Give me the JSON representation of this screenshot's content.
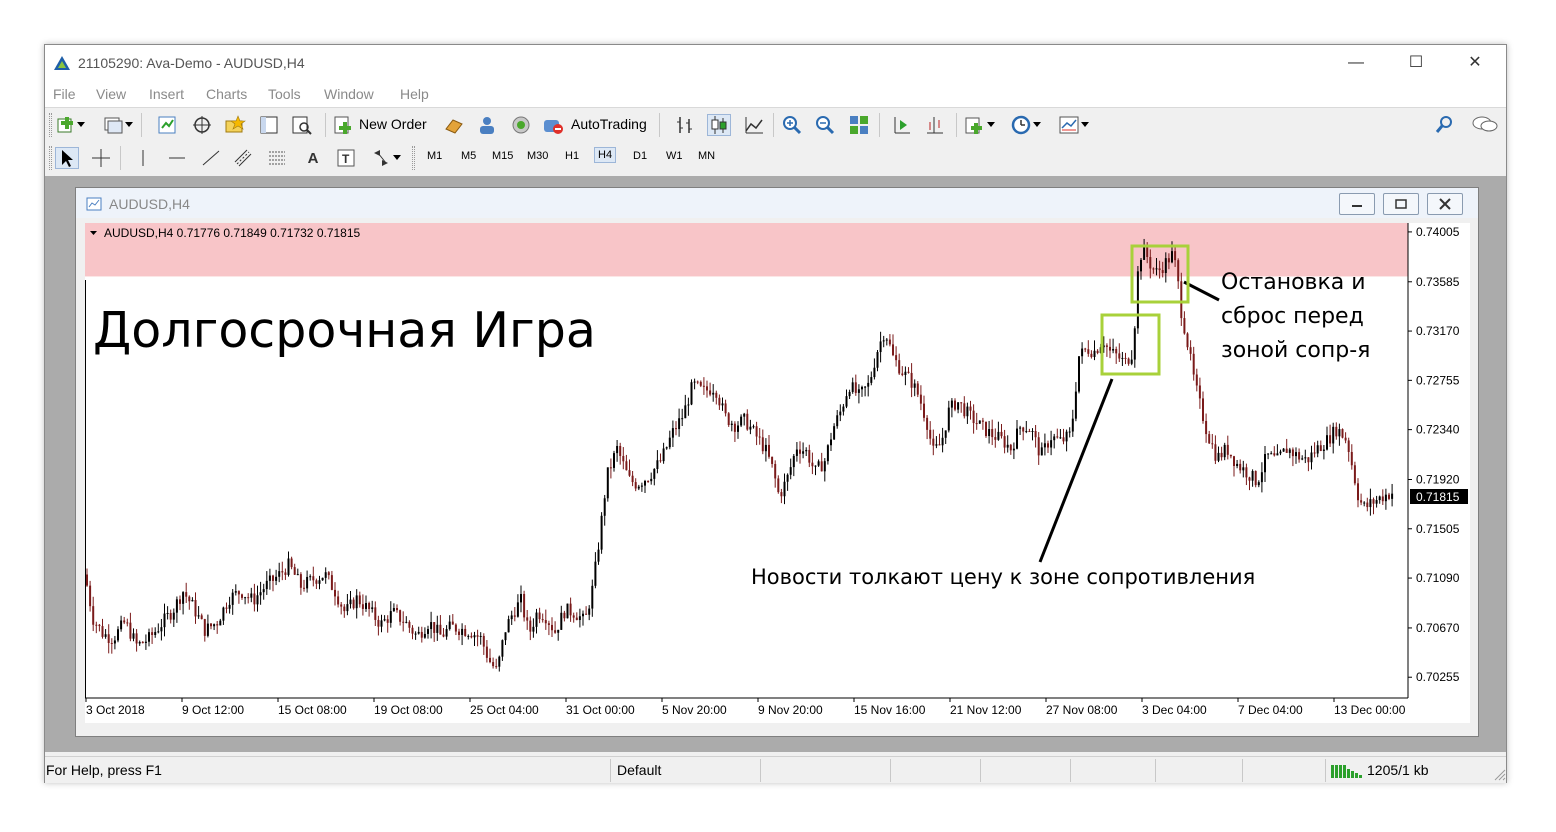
{
  "window": {
    "title": "21105290: Ava-Demo - AUDUSD,H4",
    "minimize": "—",
    "maximize": "☐",
    "close": "✕"
  },
  "menu": [
    "File",
    "View",
    "Insert",
    "Charts",
    "Tools",
    "Window",
    "Help"
  ],
  "toolbar": {
    "new_order": "New Order",
    "autotrading": "AutoTrading",
    "timeframes": [
      "M1",
      "M5",
      "M15",
      "M30",
      "H1",
      "H4",
      "D1",
      "W1",
      "MN"
    ],
    "selected_timeframe": "H4",
    "text_tool": "A"
  },
  "chart_window": {
    "title": "AUDUSD,H4",
    "info": "AUDUSD,H4  0.71776 0.71849 0.71732 0.71815",
    "current_price": "0.71815"
  },
  "annotations": {
    "heading": "Долгосрочная Игра",
    "stop_note": [
      "Остановка и",
      "сброс перед",
      "зоной сопр-я"
    ],
    "news_note": "Новости толкают цену к зоне сопротивления"
  },
  "statusbar": {
    "help": "For Help, press F1",
    "profile": "Default",
    "traffic": "1205/1 kb"
  },
  "colors": {
    "resistance_zone": "#f8c5c8",
    "candle_up": "#000000",
    "candle_down": "#7a1a1a",
    "box_highlight": "#a8d13a",
    "price_label_bg": "#000000"
  },
  "chart_data": {
    "type": "candlestick",
    "symbol": "AUDUSD",
    "timeframe": "H4",
    "y_ticks": [
      "0.74005",
      "0.73585",
      "0.73170",
      "0.72755",
      "0.72340",
      "0.71920",
      "0.71505",
      "0.71090",
      "0.70670",
      "0.70255"
    ],
    "x_ticks": [
      "3 Oct 2018",
      "9 Oct 12:00",
      "15 Oct 08:00",
      "19 Oct 08:00",
      "25 Oct 04:00",
      "31 Oct 00:00",
      "5 Nov 20:00",
      "9 Nov 20:00",
      "15 Nov 16:00",
      "21 Nov 12:00",
      "27 Nov 08:00",
      "3 Dec 04:00",
      "7 Dec 04:00",
      "13 Dec 00:00"
    ],
    "ylim": [
      0.7008,
      0.7408
    ],
    "resistance_zone": [
      0.7363,
      0.7413
    ],
    "last_price": 0.71815,
    "close_path": [
      [
        0,
        0.7112
      ],
      [
        8,
        0.7075
      ],
      [
        18,
        0.7062
      ],
      [
        28,
        0.7058
      ],
      [
        40,
        0.7072
      ],
      [
        52,
        0.7052
      ],
      [
        64,
        0.7058
      ],
      [
        76,
        0.707
      ],
      [
        88,
        0.7082
      ],
      [
        98,
        0.7098
      ],
      [
        108,
        0.7085
      ],
      [
        120,
        0.7065
      ],
      [
        132,
        0.7072
      ],
      [
        144,
        0.7092
      ],
      [
        156,
        0.7098
      ],
      [
        168,
        0.709
      ],
      [
        180,
        0.7102
      ],
      [
        192,
        0.711
      ],
      [
        204,
        0.712
      ],
      [
        216,
        0.7102
      ],
      [
        228,
        0.7108
      ],
      [
        240,
        0.7112
      ],
      [
        250,
        0.7098
      ],
      [
        260,
        0.708
      ],
      [
        272,
        0.7092
      ],
      [
        284,
        0.7082
      ],
      [
        296,
        0.707
      ],
      [
        308,
        0.708
      ],
      [
        320,
        0.7072
      ],
      [
        332,
        0.706
      ],
      [
        344,
        0.7072
      ],
      [
        356,
        0.706
      ],
      [
        366,
        0.7068
      ],
      [
        376,
        0.7066
      ],
      [
        386,
        0.7064
      ],
      [
        396,
        0.7058
      ],
      [
        404,
        0.704
      ],
      [
        412,
        0.703
      ],
      [
        420,
        0.7065
      ],
      [
        428,
        0.708
      ],
      [
        436,
        0.709
      ],
      [
        444,
        0.7062
      ],
      [
        452,
        0.708
      ],
      [
        460,
        0.7078
      ],
      [
        470,
        0.7064
      ],
      [
        480,
        0.7082
      ],
      [
        490,
        0.708
      ],
      [
        500,
        0.7072
      ],
      [
        508,
        0.7102
      ],
      [
        514,
        0.714
      ],
      [
        522,
        0.7195
      ],
      [
        532,
        0.7218
      ],
      [
        544,
        0.7192
      ],
      [
        552,
        0.7188
      ],
      [
        564,
        0.7195
      ],
      [
        576,
        0.7208
      ],
      [
        588,
        0.7232
      ],
      [
        598,
        0.7246
      ],
      [
        608,
        0.7272
      ],
      [
        618,
        0.7266
      ],
      [
        630,
        0.727
      ],
      [
        640,
        0.7245
      ],
      [
        650,
        0.7238
      ],
      [
        660,
        0.7242
      ],
      [
        670,
        0.723
      ],
      [
        680,
        0.7218
      ],
      [
        688,
        0.72
      ],
      [
        694,
        0.7178
      ],
      [
        702,
        0.7192
      ],
      [
        712,
        0.722
      ],
      [
        722,
        0.7215
      ],
      [
        730,
        0.7198
      ],
      [
        740,
        0.7208
      ],
      [
        748,
        0.7235
      ],
      [
        756,
        0.725
      ],
      [
        764,
        0.7272
      ],
      [
        774,
        0.7262
      ],
      [
        784,
        0.7272
      ],
      [
        792,
        0.73
      ],
      [
        800,
        0.7318
      ],
      [
        808,
        0.7295
      ],
      [
        818,
        0.7282
      ],
      [
        826,
        0.7275
      ],
      [
        834,
        0.7262
      ],
      [
        842,
        0.724
      ],
      [
        848,
        0.7215
      ],
      [
        856,
        0.7222
      ],
      [
        864,
        0.725
      ],
      [
        872,
        0.7258
      ],
      [
        882,
        0.7248
      ],
      [
        894,
        0.7238
      ],
      [
        906,
        0.723
      ],
      [
        916,
        0.7226
      ],
      [
        926,
        0.7218
      ],
      [
        936,
        0.7238
      ],
      [
        946,
        0.7234
      ],
      [
        956,
        0.7212
      ],
      [
        966,
        0.7228
      ],
      [
        976,
        0.7224
      ],
      [
        986,
        0.723
      ],
      [
        994,
        0.7296
      ],
      [
        1002,
        0.7302
      ],
      [
        1010,
        0.73
      ],
      [
        1018,
        0.731
      ],
      [
        1024,
        0.73
      ],
      [
        1032,
        0.7296
      ],
      [
        1040,
        0.729
      ],
      [
        1048,
        0.73
      ],
      [
        1054,
        0.738
      ],
      [
        1060,
        0.7384
      ],
      [
        1066,
        0.7372
      ],
      [
        1072,
        0.7366
      ],
      [
        1078,
        0.7372
      ],
      [
        1084,
        0.7378
      ],
      [
        1088,
        0.7382
      ],
      [
        1092,
        0.7365
      ],
      [
        1096,
        0.7335
      ],
      [
        1100,
        0.7318
      ],
      [
        1104,
        0.73
      ],
      [
        1108,
        0.728
      ],
      [
        1114,
        0.7258
      ],
      [
        1122,
        0.7232
      ],
      [
        1132,
        0.721
      ],
      [
        1142,
        0.7218
      ],
      [
        1152,
        0.7205
      ],
      [
        1162,
        0.7198
      ],
      [
        1172,
        0.719
      ],
      [
        1182,
        0.7212
      ],
      [
        1192,
        0.7208
      ],
      [
        1202,
        0.7218
      ],
      [
        1212,
        0.7212
      ],
      [
        1222,
        0.7208
      ],
      [
        1232,
        0.7218
      ],
      [
        1242,
        0.7225
      ],
      [
        1252,
        0.7235
      ],
      [
        1262,
        0.7225
      ],
      [
        1268,
        0.72
      ],
      [
        1274,
        0.7175
      ],
      [
        1280,
        0.7168
      ],
      [
        1286,
        0.7172
      ],
      [
        1292,
        0.7175
      ],
      [
        1298,
        0.7178
      ],
      [
        1304,
        0.718
      ],
      [
        1310,
        0.7182
      ]
    ]
  }
}
